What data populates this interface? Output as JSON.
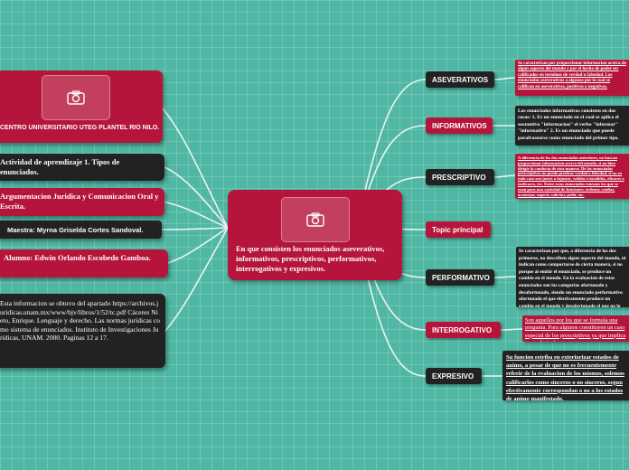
{
  "central": {
    "title": "En que consisten los enunciados aseverativos, informativos, prescriptivos, performativos, interrogativos y expresivos."
  },
  "left_nodes": {
    "institution": "CENTRO UNIVERSITARIO UTEG PLANTEL RIO NILO.",
    "activity": "Actividad de aprendizaje 1. Tipos de enunciados.",
    "course": "Argumentacion Juridica y Comunicacion Oral y Escrita.",
    "teacher": "Maestra: Myrna Griselda Cortes Sandoval.",
    "student": "Alumno: Edwin Orlando Escobedo Gamboa.",
    "source": "Esta informacion se obtuvo del apartado https://archivos.juridicas.unam.mx/www/bjv/libros/1/52/tc.pdf    Cáceres Nieto, Enrique. Lenguaje y derecho. Las normas jurídicas como sistema de enunciados. Instituto de Investigaciones Jurídicas, UNAM. 2000. Paginas 12 a 17."
  },
  "topics": {
    "aseverativos": {
      "label": "ASEVERATIVOS",
      "note": "Se caracterizan por proporcionar informacion acerca de algun aspecto del mundo y por el hecho de poder ser calificados en terminos de verdad o falsedad. Los enunciados aseverativos a algunos por lo cual se califican en aseverativos, positivos o negativos."
    },
    "informativos": {
      "label": "INFORMATIVOS",
      "note": "Los enunciados informativos consisten en dos cosas: 1. Es un enunciado en el cual se aplica el sustantivo \"informacion\" el verbo \"informar\" \"informativo\" 2. Es un enunciado que puede parafrasearse como enunciado del primer tipo."
    },
    "prescriptivo": {
      "label": "PRESCRIPTIVO",
      "note": "A diferencia de los dos enunciados anteriores, no buscan proporcionar informacion acerca del mundo, si no bien dirigir la conducta de otra manera. De los enunciados prescriptivos no puede predicar verdad o falsedad, si no en todo caso son justos o injustos, validos o invalidos, eficaces o ineficaces, etc. Entre estos enunciados tenemos los que se usan para una variedad de funciones: ordenar, confiar, aconsejar, sugerir, solicitar, pedir, etc."
    },
    "principal": {
      "label": "Topic principal"
    },
    "performativo": {
      "label": "PERFORMATIVO",
      "note": "Se caracterizan por que, a diferencia de los dos primeros, no describen algun aspecto del mundo, ni indican como comportarse de cierta manera, si no porque al emitir el enunciado, se produce un cambio en el mundo. En la evaluacion de estos enunciados son las categorias afortunado y desafortunado, siendo un enunciado performativo afortunado el que efectivamente produce un cambio en el mundo y desafortunado el que no lo produce."
    },
    "interrogativo": {
      "label": "INTERROGATIVO",
      "note": "Son aquellos por los que se formula una pregunta. Para algunos constituyen un caso especial de los prescriptivos ya que implica una solicitud."
    },
    "expresivo": {
      "label": "EXPRESIVO",
      "note": "Su funcion estriba en exteriorizar estados de animo, a pesar de que no es frecuentemente referir de la evaluacion de los mismos, solemos calificarlos como sinceros o no sinceros, segun efectivamente correspondan o no a los estados de animo manifestado."
    }
  },
  "icons": {
    "photo": "camera-icon"
  },
  "colors": {
    "background": "#4fb7a3",
    "node_red": "#b5153a",
    "node_black": "#222222",
    "branch_line": "#e9f4f1"
  }
}
